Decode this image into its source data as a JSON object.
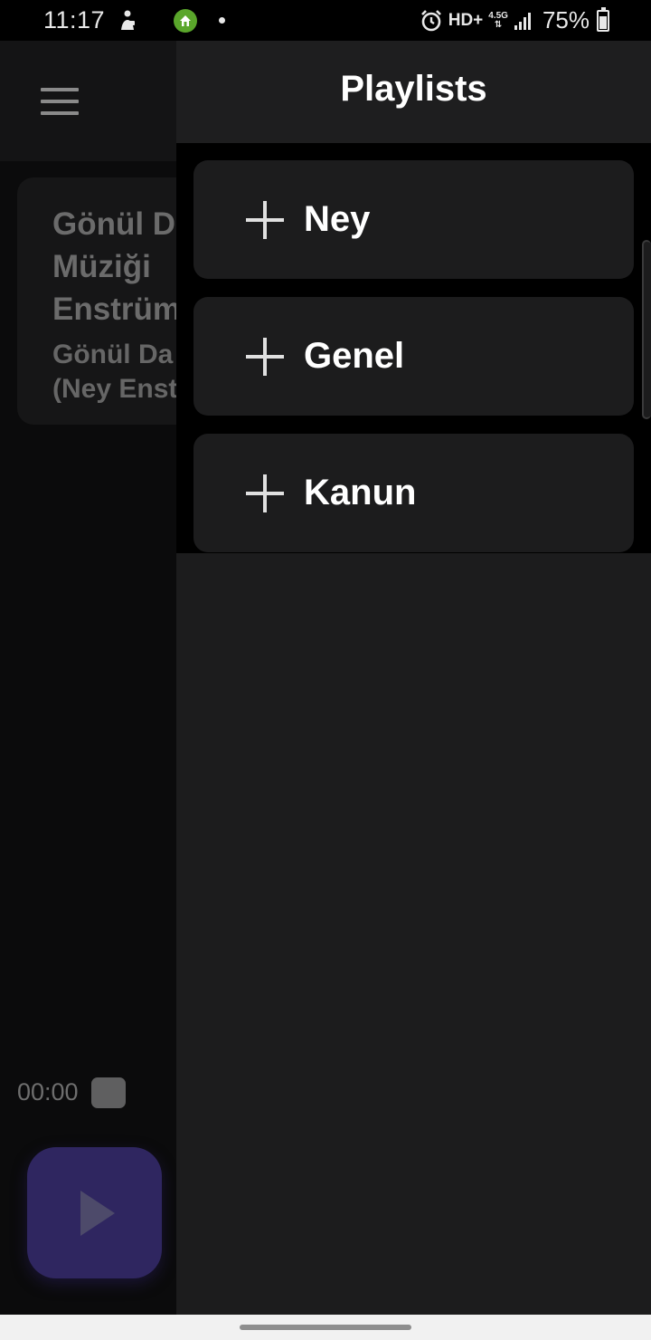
{
  "status_bar": {
    "time": "11:17",
    "network": "HD+",
    "network_type": "4.5G",
    "battery": "75%",
    "icons": [
      "accessibility-person-icon",
      "home-app-icon",
      "notification-dot-icon",
      "alarm-icon",
      "signal-icon",
      "battery-charging-icon"
    ]
  },
  "background_app": {
    "menu_icon": "hamburger-menu-icon",
    "track_title": "Gönül D\nMüziği\nEnstrüm",
    "track_subtitle": "Gönül Da\n(Ney Enst",
    "elapsed_time": "00:00",
    "play_icon": "play-icon",
    "accent_color": "#2f2660"
  },
  "drawer": {
    "title": "Playlists",
    "items": [
      {
        "label": "Ney",
        "icon": "plus-icon"
      },
      {
        "label": "Genel",
        "icon": "plus-icon"
      },
      {
        "label": "Kanun",
        "icon": "plus-icon"
      }
    ]
  }
}
